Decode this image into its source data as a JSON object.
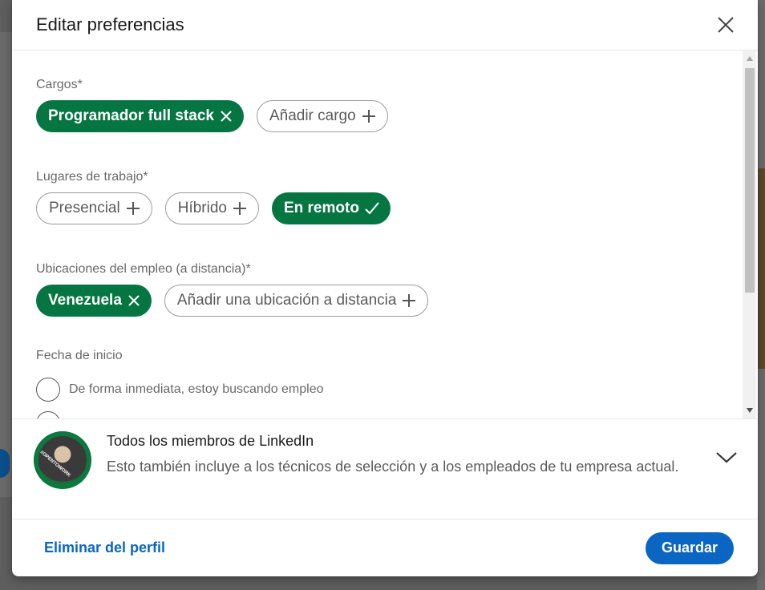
{
  "modal": {
    "title": "Editar preferencias",
    "close_icon": "close-icon"
  },
  "sections": {
    "job_titles": {
      "label": "Cargos*",
      "selected": [
        {
          "label": "Programador full stack",
          "icon": "remove-icon"
        }
      ],
      "add_label": "Añadir cargo"
    },
    "workplaces": {
      "label": "Lugares de trabajo*",
      "options": [
        {
          "label": "Presencial",
          "selected": false
        },
        {
          "label": "Híbrido",
          "selected": false
        },
        {
          "label": "En remoto",
          "selected": true
        }
      ]
    },
    "remote_locations": {
      "label": "Ubicaciones del empleo (a distancia)*",
      "selected": [
        {
          "label": "Venezuela",
          "icon": "remove-icon"
        }
      ],
      "add_label": "Añadir una ubicación a distancia"
    },
    "start_date": {
      "label": "Fecha de inicio",
      "options": [
        {
          "label": "De forma inmediata, estoy buscando empleo",
          "checked": false
        }
      ]
    }
  },
  "visibility": {
    "title": "Todos los miembros de LinkedIn",
    "description": "Esto también incluye a los técnicos de selección y a los empleados de tu empresa actual.",
    "avatar_badge": "#OPENTOWORK"
  },
  "footer": {
    "delete_label": "Eliminar del perfil",
    "save_label": "Guardar"
  },
  "colors": {
    "selected_green": "#057642",
    "primary_blue": "#0a66c2"
  }
}
